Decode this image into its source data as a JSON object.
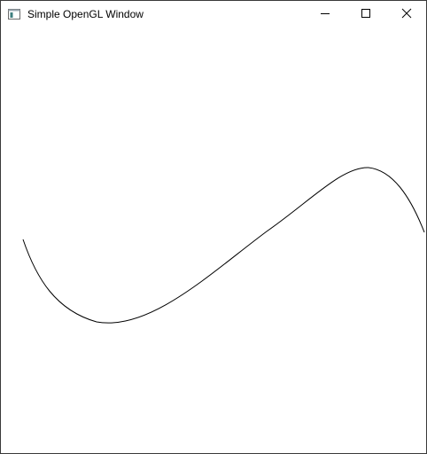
{
  "window": {
    "title": "Simple OpenGL Window",
    "icons": {
      "app": "opengl-window-app-icon",
      "minimize": "minimize-icon",
      "maximize": "maximize-icon",
      "close": "close-icon"
    }
  },
  "scene": {
    "background_color": "#ffffff",
    "curve_color": "#000000",
    "curve_description": "single black spline curve drawn in the viewport"
  }
}
